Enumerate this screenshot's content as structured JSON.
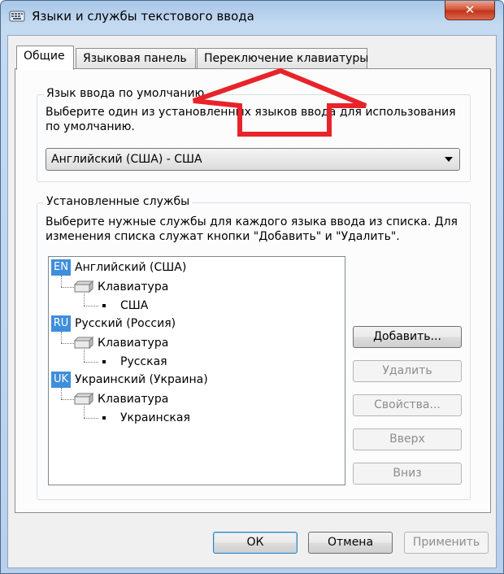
{
  "window": {
    "title": "Языки и службы текстового ввода",
    "close_label": "✕"
  },
  "tabs": [
    {
      "label": "Общие",
      "active": true
    },
    {
      "label": "Языковая панель",
      "active": false
    },
    {
      "label": "Переключение клавиатуры",
      "active": false
    }
  ],
  "default_language": {
    "label": "Язык ввода по умолчанию",
    "description_line1": "Выберите один из установленных языков ввода для использования",
    "description_line2": "по умолчанию.",
    "selected": "Английский (США) - США"
  },
  "installed_services": {
    "label": "Установленные службы",
    "description_line1": "Выберите нужные службы для каждого языка ввода из списка. Для",
    "description_line2": "изменения списка служат кнопки \"Добавить\" и \"Удалить\".",
    "languages": [
      {
        "code": "EN",
        "name": "Английский (США)",
        "category": "Клавиатура",
        "layout": "США"
      },
      {
        "code": "RU",
        "name": "Русский (Россия)",
        "category": "Клавиатура",
        "layout": "Русская"
      },
      {
        "code": "UK",
        "name": "Украинский (Украина)",
        "category": "Клавиатура",
        "layout": "Украинская"
      }
    ]
  },
  "side_buttons": {
    "add": "Добавить...",
    "remove": "Удалить",
    "properties": "Свойства...",
    "up": "Вверх",
    "down": "Вниз"
  },
  "footer_buttons": {
    "ok": "ОК",
    "cancel": "Отмена",
    "apply": "Применить"
  },
  "colors": {
    "badge": "#3f8edb",
    "annotation_arrow": "#e8232a"
  }
}
